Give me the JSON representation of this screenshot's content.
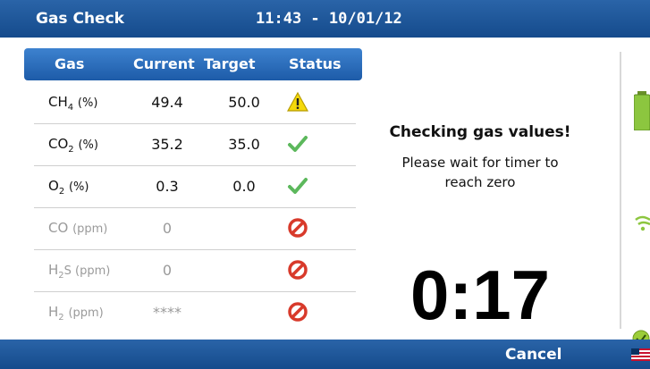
{
  "header": {
    "app_title": "Gas Check",
    "datetime": "11:43 - 10/01/12"
  },
  "table": {
    "columns": [
      "Gas",
      "Current",
      "Target",
      "Status"
    ],
    "rows": [
      {
        "gas": "CH",
        "sub": "4",
        "unit": "(%)",
        "current": "49.4",
        "target": "50.0",
        "status": "warning-icon",
        "dim": false
      },
      {
        "gas": "CO",
        "sub": "2",
        "unit": "(%)",
        "current": "35.2",
        "target": "35.0",
        "status": "check-icon",
        "dim": false
      },
      {
        "gas": "O",
        "sub": "2",
        "unit": "(%)",
        "current": "0.3",
        "target": "0.0",
        "status": "check-icon",
        "dim": false
      },
      {
        "gas": "CO",
        "sub": "",
        "unit": "(ppm)",
        "current": "0",
        "target": "",
        "status": "no-icon",
        "dim": true
      },
      {
        "gas": "H",
        "sub": "2",
        "unit": "S (ppm)",
        "current": "0",
        "target": "",
        "status": "no-icon",
        "dim": true
      },
      {
        "gas": "H",
        "sub": "2",
        "unit": "(ppm)",
        "current": "****",
        "target": "",
        "status": "no-icon",
        "dim": true
      }
    ]
  },
  "message": {
    "title": "Checking gas values!",
    "body": "Please wait for timer to reach zero"
  },
  "timer": "0:17",
  "footer": {
    "cancel_label": "Cancel"
  },
  "icons": [
    "battery-icon",
    "wifi-icon",
    "ok-status-icon",
    "flag-icon"
  ],
  "colors": {
    "bar": "#1d5ba8",
    "ok": "#5cb85c",
    "warning": "#f5d90a",
    "error": "#d83a2b"
  }
}
